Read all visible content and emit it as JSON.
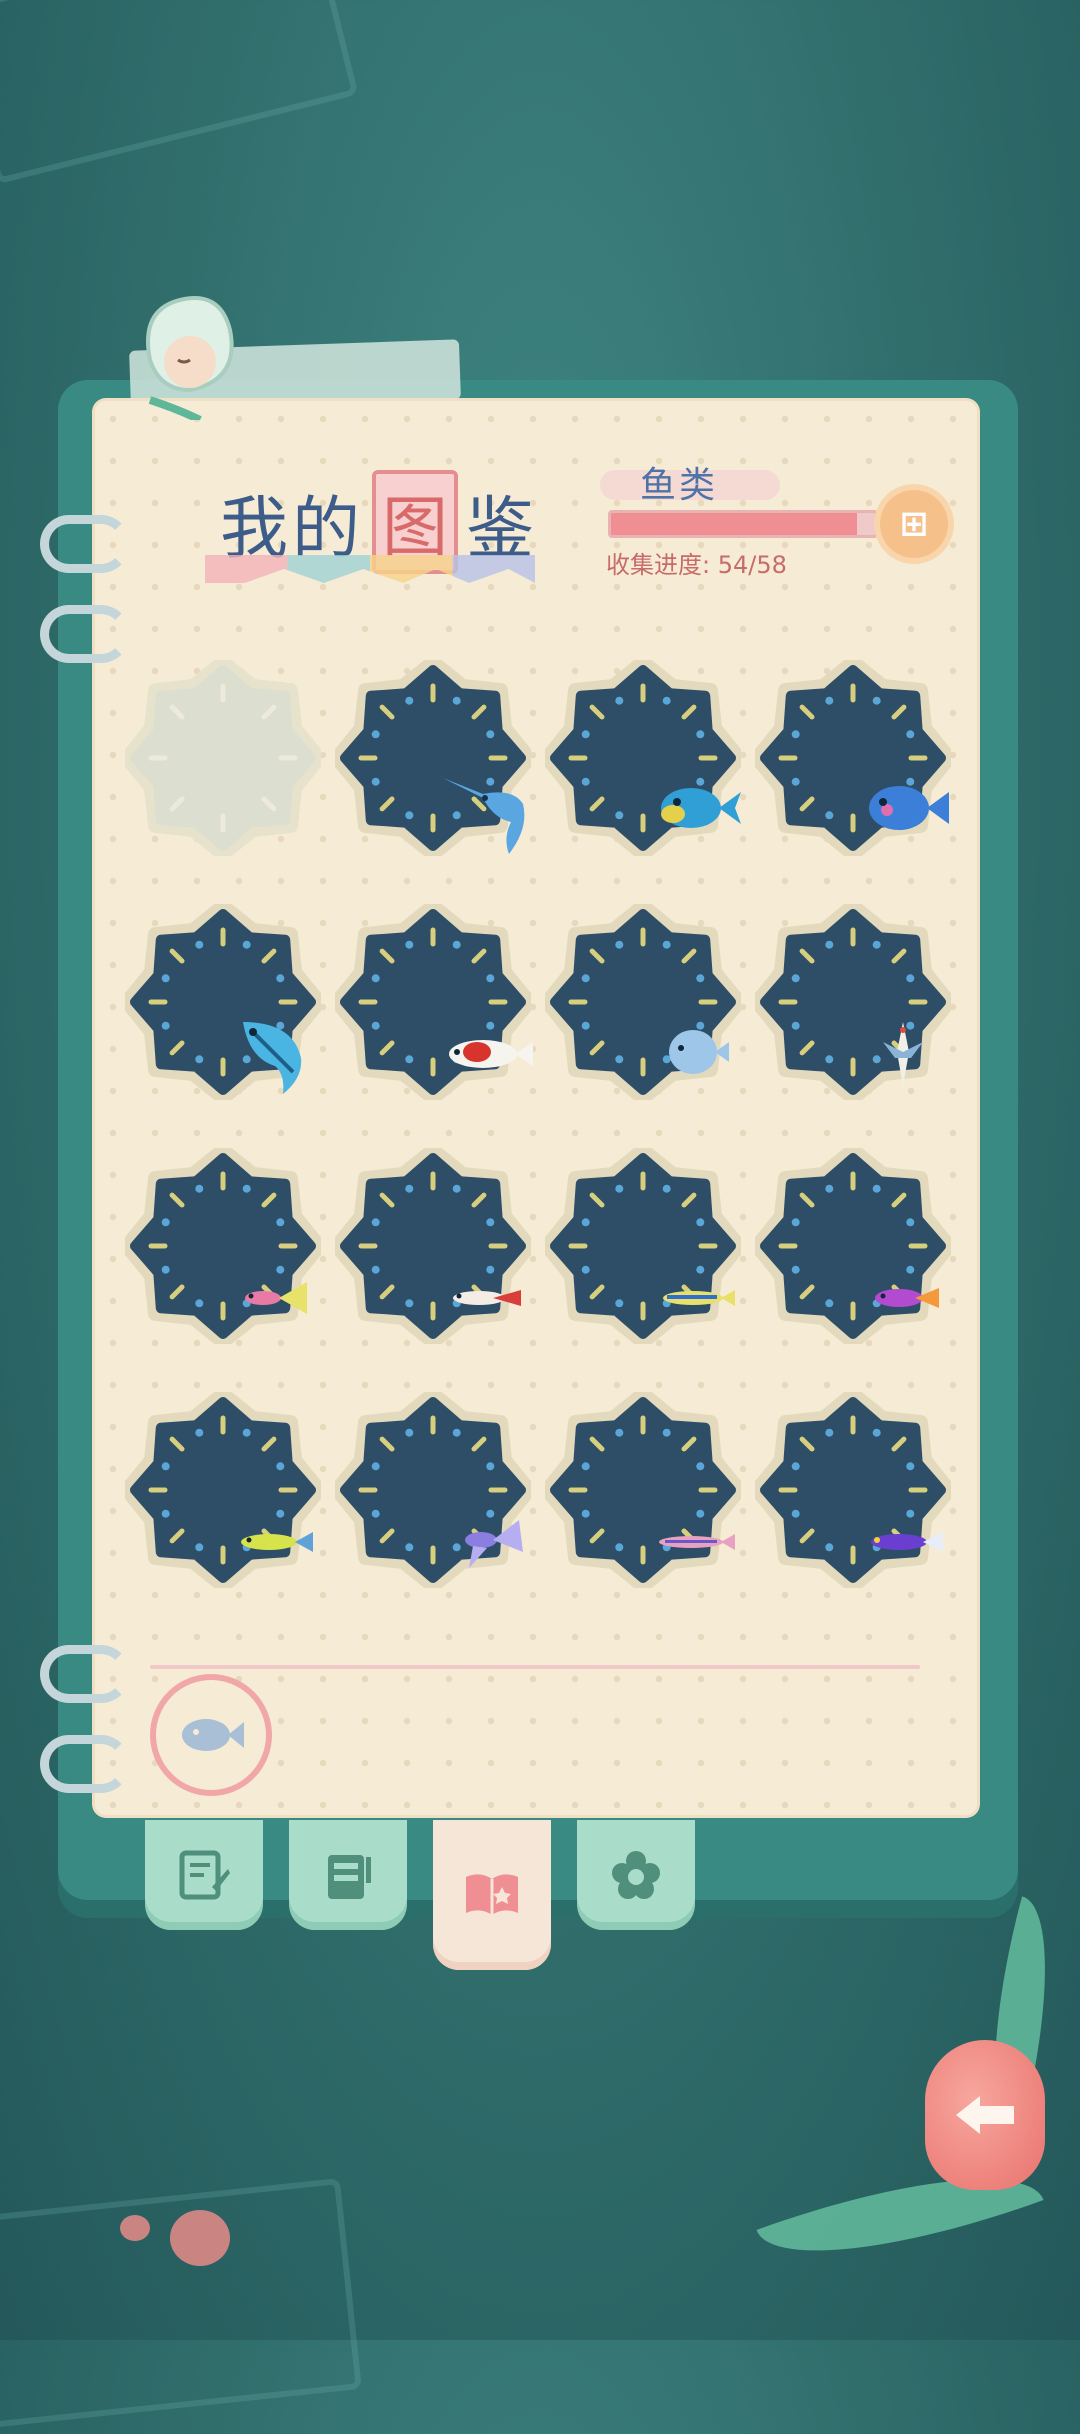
{
  "header": {
    "title_part1": "我的",
    "title_part2": "图",
    "title_part3": "鉴",
    "category": "鱼类",
    "progress_label": "收集进度: 54/58",
    "progress_fraction": 0.931
  },
  "colors": {
    "badge_dark": "#2e4d66",
    "badge_locked": "#dcdfcf",
    "accent_pink": "#ef8f93",
    "tab_green": "#a9dcc9"
  },
  "collection": [
    {
      "id": "slot-1",
      "locked": true,
      "fish": "locked"
    },
    {
      "id": "slot-2",
      "locked": false,
      "fish": "swordfish"
    },
    {
      "id": "slot-3",
      "locked": false,
      "fish": "parrotfish"
    },
    {
      "id": "slot-4",
      "locked": false,
      "fish": "pufferfish"
    },
    {
      "id": "slot-5",
      "locked": false,
      "fish": "blue-tuna"
    },
    {
      "id": "slot-6",
      "locked": false,
      "fish": "koi"
    },
    {
      "id": "slot-7",
      "locked": false,
      "fish": "discus"
    },
    {
      "id": "slot-8",
      "locked": false,
      "fish": "flying-fish"
    },
    {
      "id": "slot-9",
      "locked": false,
      "fish": "guppy"
    },
    {
      "id": "slot-10",
      "locked": false,
      "fish": "red-tail"
    },
    {
      "id": "slot-11",
      "locked": false,
      "fish": "neon-tetra"
    },
    {
      "id": "slot-12",
      "locked": false,
      "fish": "dottyback"
    },
    {
      "id": "slot-13",
      "locked": false,
      "fish": "lime-fish"
    },
    {
      "id": "slot-14",
      "locked": false,
      "fish": "betta"
    },
    {
      "id": "slot-15",
      "locked": false,
      "fish": "pink-minnow"
    },
    {
      "id": "slot-16",
      "locked": false,
      "fish": "purple-dart"
    }
  ],
  "tabs": [
    {
      "icon": "note-pencil-icon",
      "active": false
    },
    {
      "icon": "clipboard-icon",
      "active": false
    },
    {
      "icon": "open-book-icon",
      "active": true
    },
    {
      "icon": "flower-icon",
      "active": false
    }
  ],
  "icons": {
    "filter": "fish-filter-icon",
    "gift": "gift-icon",
    "back": "back-arrow-icon"
  }
}
